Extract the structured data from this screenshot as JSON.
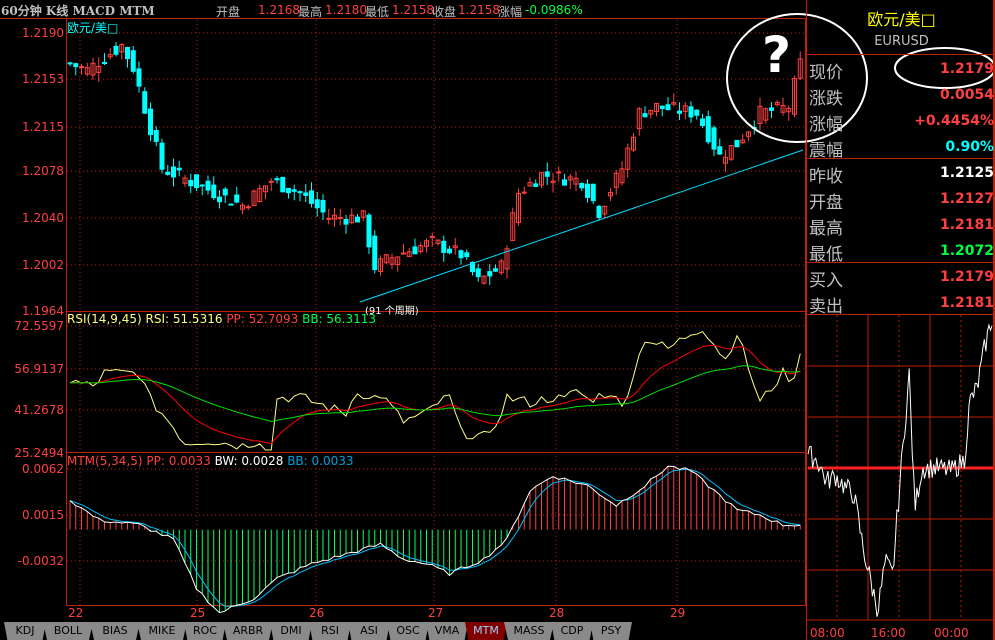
{
  "header": {
    "title": "60分钟 K线 MACD MTM",
    "open_label": "开盘",
    "open": "1.2168",
    "high_label": "最高",
    "high": "1.2180",
    "low_label": "最低",
    "low": "1.2158",
    "close_label": "收盘",
    "close": "1.2158",
    "chg_label": "涨幅",
    "chg": "-0.0986%"
  },
  "main": {
    "symbol_label": "欧元/美□",
    "price_ticks": [
      "1.2190",
      "1.2153",
      "1.2115",
      "1.2078",
      "1.2040",
      "1.2002",
      "1.1964"
    ],
    "trend_note": "(91 个周期)",
    "question_mark": "?"
  },
  "rsi": {
    "title": "RSI(14,9,45)",
    "rsi_label": "RSI: 51.5316",
    "pp_label": "PP: 52.7093",
    "bb_label": "BB: 56.3113",
    "ticks": [
      "72.5597",
      "56.9137",
      "41.2678",
      "25.2494"
    ]
  },
  "mtm": {
    "title": "MTM(5,34,5)",
    "pp_label": "PP: 0.0033",
    "bw_label": "BW: 0.0028",
    "bb_label": "BB: 0.0033",
    "ticks": [
      "0.0062",
      "0.0015",
      "-0.0032"
    ]
  },
  "xaxis": [
    "22",
    "25",
    "26",
    "27",
    "28",
    "29"
  ],
  "tabs": [
    "KDJ",
    "BOLL",
    "BIAS",
    "MIKE",
    "ROC",
    "ARBR",
    "DMI",
    "RSI",
    "ASI",
    "OSC",
    "VMA",
    "MTM",
    "MASS",
    "CDP",
    "PSY"
  ],
  "active_tab": "MTM",
  "quote": {
    "name": "欧元/美□",
    "code": "EURUSD",
    "rows": [
      {
        "k": "现价",
        "v": "1.2179"
      },
      {
        "k": "涨跌",
        "v": "0.0054"
      },
      {
        "k": "涨幅",
        "v": "+0.4454%"
      },
      {
        "k": "震幅",
        "v": "0.90%"
      },
      {
        "k": "昨收",
        "v": "1.2125"
      },
      {
        "k": "开盘",
        "v": "1.2127"
      },
      {
        "k": "最高",
        "v": "1.2181"
      },
      {
        "k": "最低",
        "v": "1.2072"
      },
      {
        "k": "买入",
        "v": "1.2179"
      },
      {
        "k": "卖出",
        "v": "1.2181"
      }
    ],
    "time_ticks": [
      "08:00",
      "16:00",
      "00:00"
    ]
  },
  "colors": {
    "up": "#ff4040",
    "down": "#00ffff",
    "grid": "#c02000",
    "rsi": "#ffff80",
    "pp": "#ff0000",
    "bb": "#00e000",
    "mtm": "#ffffff",
    "mtm_ma": "#00c0ff"
  },
  "chart_data": {
    "type": "candlestick",
    "bars": 128,
    "price_range": [
      1.1964,
      1.219
    ],
    "close_keypoints": [
      [
        0,
        1.2165
      ],
      [
        3,
        1.216
      ],
      [
        9,
        1.218
      ],
      [
        11,
        1.2162
      ],
      [
        16,
        1.208
      ],
      [
        23,
        1.2065
      ],
      [
        30,
        1.205
      ],
      [
        35,
        1.207
      ],
      [
        40,
        1.206
      ],
      [
        45,
        1.204
      ],
      [
        51,
        1.204
      ],
      [
        53,
        1.2
      ],
      [
        57,
        1.201
      ],
      [
        63,
        1.202
      ],
      [
        68,
        1.201
      ],
      [
        71,
        1.1988
      ],
      [
        75,
        1.2
      ],
      [
        78,
        1.206
      ],
      [
        82,
        1.2075
      ],
      [
        89,
        1.207
      ],
      [
        92,
        1.2045
      ],
      [
        96,
        1.208
      ],
      [
        99,
        1.2125
      ],
      [
        102,
        1.213
      ],
      [
        109,
        1.2125
      ],
      [
        113,
        1.209
      ],
      [
        116,
        1.21
      ],
      [
        120,
        1.2125
      ],
      [
        125,
        1.213
      ],
      [
        127,
        1.2165
      ]
    ],
    "rsi_range": [
      25.2494,
      72.5597
    ],
    "rsi_keypoints": [
      [
        0,
        52
      ],
      [
        4,
        50
      ],
      [
        6,
        55
      ],
      [
        12,
        55
      ],
      [
        14,
        45
      ],
      [
        18,
        35
      ],
      [
        20,
        29
      ],
      [
        24,
        30
      ],
      [
        30,
        28
      ],
      [
        33,
        30
      ],
      [
        35,
        26
      ],
      [
        36,
        46
      ],
      [
        40,
        46
      ],
      [
        44,
        43
      ],
      [
        48,
        40
      ],
      [
        50,
        49
      ],
      [
        52,
        45
      ],
      [
        54,
        47
      ],
      [
        58,
        37
      ],
      [
        62,
        40
      ],
      [
        64,
        44
      ],
      [
        66,
        46
      ],
      [
        68,
        33
      ],
      [
        73,
        31
      ],
      [
        76,
        46
      ],
      [
        80,
        44
      ],
      [
        84,
        46
      ],
      [
        86,
        45
      ],
      [
        88,
        49
      ],
      [
        90,
        45
      ],
      [
        94,
        48
      ],
      [
        96,
        42
      ],
      [
        100,
        68
      ],
      [
        104,
        64
      ],
      [
        108,
        70
      ],
      [
        110,
        72
      ],
      [
        114,
        60
      ],
      [
        116,
        70
      ],
      [
        120,
        44
      ],
      [
        124,
        55
      ],
      [
        126,
        52
      ],
      [
        127,
        64
      ]
    ],
    "mtm_range": [
      -0.0078,
      0.0068
    ],
    "mtm_keypoints": [
      [
        0,
        0.003
      ],
      [
        5,
        0.001
      ],
      [
        12,
        0.0005
      ],
      [
        18,
        -0.001
      ],
      [
        22,
        -0.006
      ],
      [
        26,
        -0.0085
      ],
      [
        32,
        -0.007
      ],
      [
        36,
        -0.005
      ],
      [
        42,
        -0.0035
      ],
      [
        48,
        -0.0025
      ],
      [
        54,
        -0.0015
      ],
      [
        58,
        -0.003
      ],
      [
        62,
        -0.0035
      ],
      [
        66,
        -0.0045
      ],
      [
        72,
        -0.003
      ],
      [
        76,
        -0.001
      ],
      [
        80,
        0.004
      ],
      [
        84,
        0.0055
      ],
      [
        90,
        0.0045
      ],
      [
        95,
        0.0025
      ],
      [
        100,
        0.0045
      ],
      [
        104,
        0.0065
      ],
      [
        108,
        0.006
      ],
      [
        112,
        0.004
      ],
      [
        116,
        0.002
      ],
      [
        120,
        0.0015
      ],
      [
        124,
        0.0005
      ],
      [
        127,
        0.0005
      ]
    ],
    "intraday_range": [
      1.2072,
      1.2181
    ],
    "intraday_prev_close": 1.2125,
    "intraday_keypoints": [
      [
        0,
        1.213
      ],
      [
        5,
        1.2128
      ],
      [
        10,
        1.212
      ],
      [
        15,
        1.2122
      ],
      [
        20,
        1.2118
      ],
      [
        25,
        1.2115
      ],
      [
        30,
        1.2095
      ],
      [
        35,
        1.208
      ],
      [
        38,
        1.2072
      ],
      [
        42,
        1.209
      ],
      [
        46,
        1.2085
      ],
      [
        50,
        1.212
      ],
      [
        55,
        1.216
      ],
      [
        58,
        1.211
      ],
      [
        62,
        1.2125
      ],
      [
        70,
        1.2125
      ],
      [
        78,
        1.2124
      ],
      [
        85,
        1.2128
      ],
      [
        88,
        1.215
      ],
      [
        92,
        1.2155
      ],
      [
        96,
        1.217
      ],
      [
        100,
        1.2181
      ]
    ]
  }
}
